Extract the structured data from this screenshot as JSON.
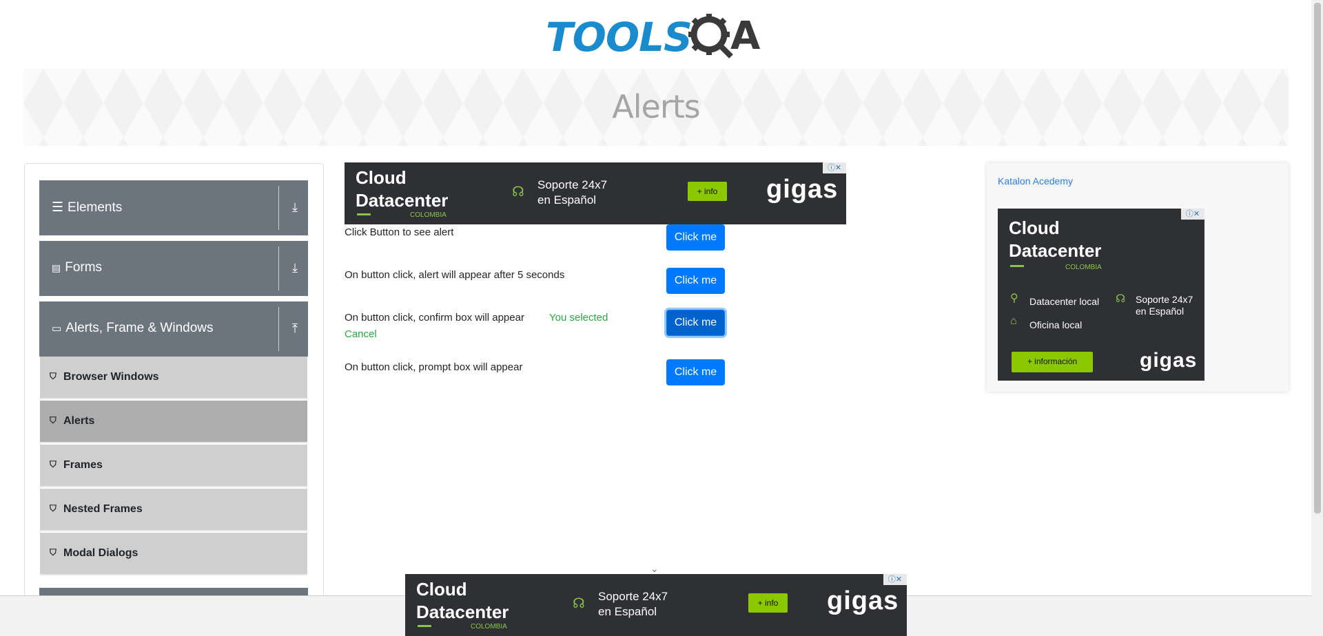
{
  "logo": {
    "tools": "TOOLS",
    "a": "A"
  },
  "banner": {
    "title": "Alerts"
  },
  "sidebar": {
    "groups": [
      {
        "label": "Elements"
      },
      {
        "label": "Forms"
      },
      {
        "label": "Alerts, Frame & Windows"
      }
    ],
    "items": [
      {
        "label": "Browser Windows"
      },
      {
        "label": "Alerts"
      },
      {
        "label": "Frames"
      },
      {
        "label": "Nested Frames"
      },
      {
        "label": "Modal Dialogs"
      }
    ]
  },
  "ad_top": {
    "title1": "Cloud",
    "title2": "Datacenter",
    "country": "COLOMBIA",
    "support1": "Soporte 24x7",
    "support2": "en Español",
    "info": "+ info",
    "brand": "gigas"
  },
  "alerts": {
    "rows": [
      {
        "text": "Click Button to see alert",
        "button": "Click me"
      },
      {
        "text": "On button click, alert will appear after 5 seconds",
        "button": "Click me"
      },
      {
        "text": "On button click, confirm box will appear",
        "result1": "You selected",
        "result2": "Cancel",
        "button": "Click me"
      },
      {
        "text": "On button click, prompt box will appear",
        "button": "Click me"
      }
    ]
  },
  "right_ad": {
    "link": "Katalon Acedemy",
    "title1": "Cloud",
    "title2": "Datacenter",
    "country": "COLOMBIA",
    "feature1": "Datacenter local",
    "feature2": "Soporte 24x7",
    "feature2b": "en Español",
    "feature3": "Oficina local",
    "info": "+ información",
    "brand": "gigas"
  },
  "ad_bottom": {
    "title1": "Cloud",
    "title2": "Datacenter",
    "country": "COLOMBIA",
    "support1": "Soporte 24x7",
    "support2": "en Español",
    "info": "+ info",
    "brand": "gigas"
  }
}
